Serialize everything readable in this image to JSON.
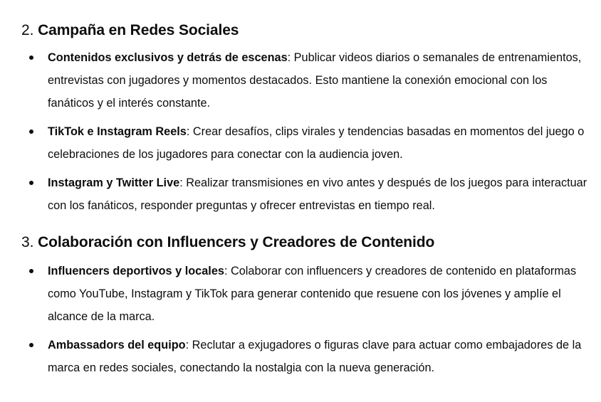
{
  "sections": [
    {
      "number": "2.",
      "title": "Campaña en Redes Sociales",
      "items": [
        {
          "term": "Contenidos exclusivos y detrás de escenas",
          "description": ": Publicar videos diarios o semanales de entrenamientos, entrevistas con jugadores y momentos destacados. Esto mantiene la conexión emocional con los fanáticos y el interés constante."
        },
        {
          "term": "TikTok e Instagram Reels",
          "description": ": Crear desafíos, clips virales y tendencias basadas en momentos del juego o celebraciones de los jugadores para conectar con la audiencia joven."
        },
        {
          "term": "Instagram y Twitter Live",
          "description": ": Realizar transmisiones en vivo antes y después de los juegos para interactuar con los fanáticos, responder preguntas y ofrecer entrevistas en tiempo real."
        }
      ]
    },
    {
      "number": "3.",
      "title": "Colaboración con Influencers y Creadores de Contenido",
      "items": [
        {
          "term": "Influencers deportivos y locales",
          "description": ": Colaborar con influencers y creadores de contenido en plataformas como YouTube, Instagram y TikTok para generar contenido que resuene con los jóvenes y amplíe el alcance de la marca."
        },
        {
          "term": "Ambassadors del equipo",
          "description": ": Reclutar a exjugadores o figuras clave para actuar como embajadores de la marca en redes sociales, conectando la nostalgia con la nueva generación."
        }
      ]
    }
  ]
}
